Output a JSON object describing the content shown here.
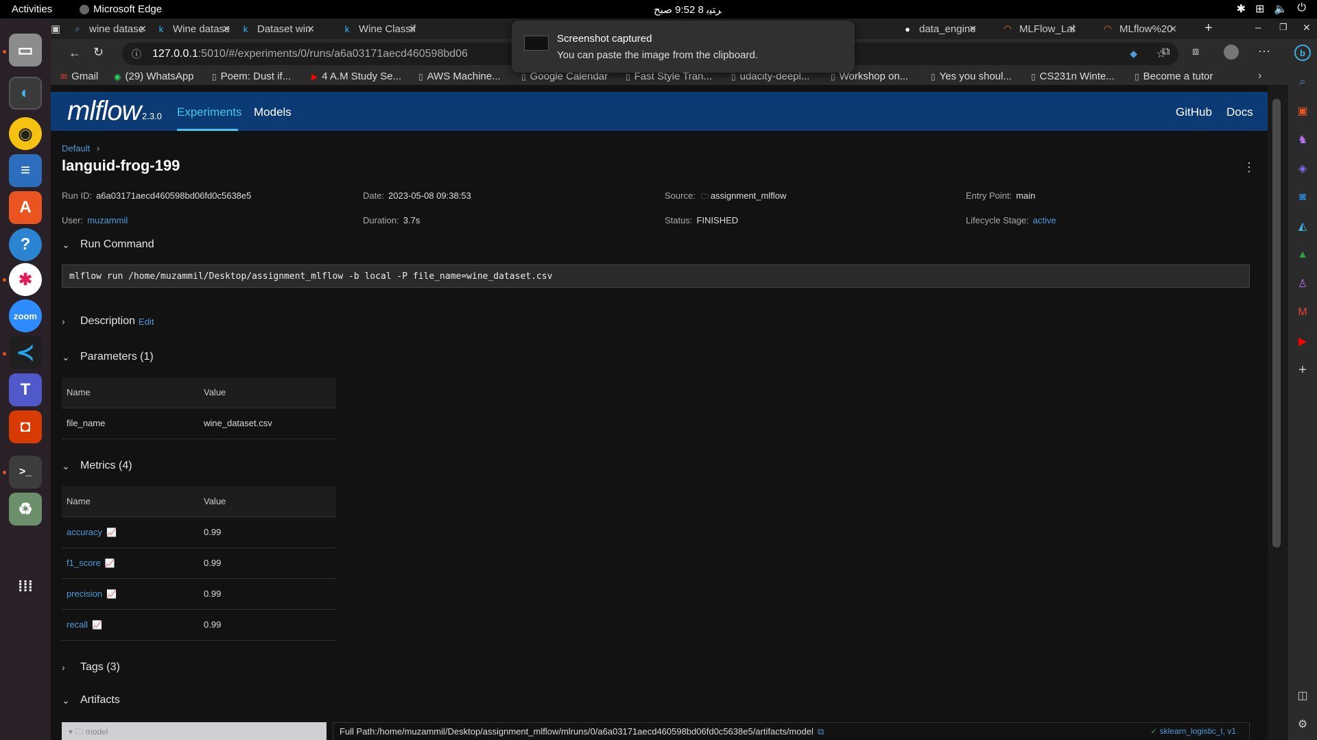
{
  "topbar": {
    "activities": "Activities",
    "app_name": "Microsoft Edge",
    "clock": "9:52  8 مئی",
    "clock_display": "ﺮﺘﯿﺑ 8  9:52 ﺻﺒﺢ"
  },
  "tabs": [
    {
      "label": "wine datase",
      "icon": "search-icon"
    },
    {
      "label": "Wine datase",
      "icon": "kaggle-icon"
    },
    {
      "label": "Dataset win",
      "icon": "kaggle-icon"
    },
    {
      "label": "Wine Classif",
      "icon": "kaggle-icon"
    },
    {
      "label": "data_engine",
      "icon": "github-icon"
    },
    {
      "label": "MLFlow_Lal",
      "icon": "jupyter-icon"
    },
    {
      "label": "MLflow%20",
      "icon": "jupyter-icon"
    }
  ],
  "address": {
    "host": "127.0.0.1",
    "rest": ":5010/#/experiments/0/runs/a6a03171aecd460598bd06"
  },
  "bookmarks": [
    {
      "label": "Gmail"
    },
    {
      "label": "(29) WhatsApp"
    },
    {
      "label": "Poem: Dust if..."
    },
    {
      "label": "4 A.M Study Se..."
    },
    {
      "label": "AWS Machine..."
    },
    {
      "label": "Google Calendar"
    },
    {
      "label": "Fast Style Tran..."
    },
    {
      "label": "udacity-deepl..."
    },
    {
      "label": "Workshop on..."
    },
    {
      "label": "Yes you shoul..."
    },
    {
      "label": "CS231n Winte..."
    },
    {
      "label": "Become a tutor"
    }
  ],
  "toast": {
    "title": "Screenshot captured",
    "body": "You can paste the image from the clipboard."
  },
  "mlflow": {
    "logo": "mlflow",
    "version": "2.3.0",
    "nav": {
      "experiments": "Experiments",
      "models": "Models",
      "github": "GitHub",
      "docs": "Docs"
    },
    "breadcrumb": "Default",
    "run_name": "languid-frog-199",
    "meta": {
      "run_id_label": "Run ID:",
      "run_id": "a6a03171aecd460598bd06fd0c5638e5",
      "date_label": "Date:",
      "date": "2023-05-08 09:38:53",
      "source_label": "Source:",
      "source": "assignment_mlflow",
      "entry_label": "Entry Point:",
      "entry": "main",
      "user_label": "User:",
      "user": "muzammil",
      "duration_label": "Duration:",
      "duration": "3.7s",
      "status_label": "Status:",
      "status": "FINISHED",
      "lifecycle_label": "Lifecycle Stage:",
      "lifecycle": "active"
    },
    "sections": {
      "run_command": "Run Command",
      "description": "Description",
      "edit": "Edit",
      "parameters": "Parameters (1)",
      "metrics": "Metrics (4)",
      "tags": "Tags (3)",
      "artifacts": "Artifacts"
    },
    "run_command": "mlflow run /home/muzammil/Desktop/assignment_mlflow -b local -P file_name=wine_dataset.csv",
    "table_headers": {
      "name": "Name",
      "value": "Value"
    },
    "parameters": [
      {
        "name": "file_name",
        "value": "wine_dataset.csv"
      }
    ],
    "metrics": [
      {
        "name": "accuracy",
        "value": "0.99"
      },
      {
        "name": "f1_score",
        "value": "0.99"
      },
      {
        "name": "precision",
        "value": "0.99"
      },
      {
        "name": "recall",
        "value": "0.99"
      }
    ],
    "artifacts": {
      "tree_item": "model",
      "full_path": "Full Path:/home/muzammil/Desktop/assignment_mlflow/mlruns/0/a6a03171aecd460598bd06fd0c5638e5/artifacts/model",
      "registered_model": "sklearn_logistic_t, v1"
    }
  }
}
